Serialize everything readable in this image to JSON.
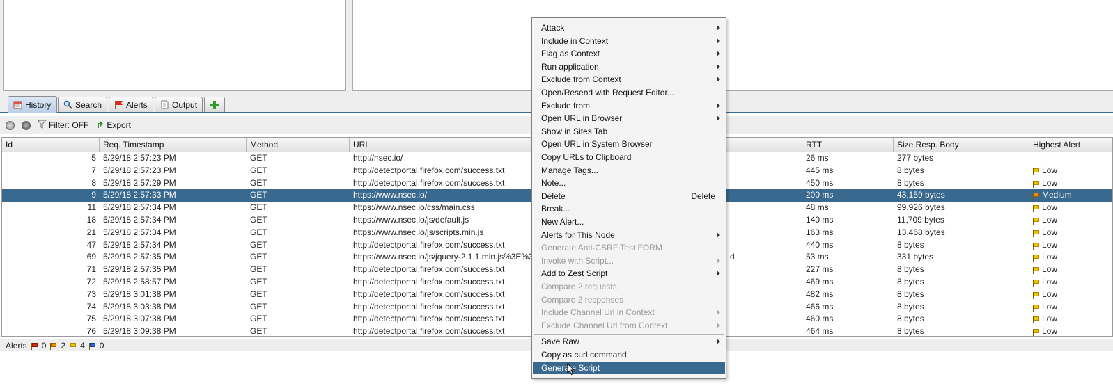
{
  "tabs": [
    {
      "label": "History",
      "icon": "history-icon",
      "active": true
    },
    {
      "label": "Search",
      "icon": "search-icon",
      "active": false
    },
    {
      "label": "Alerts",
      "icon": "alert-flag-icon",
      "active": false
    },
    {
      "label": "Output",
      "icon": "output-document-icon",
      "active": false
    }
  ],
  "toolbar": {
    "filter_label": "Filter: OFF",
    "export_label": "Export"
  },
  "columns": [
    "Id",
    "Req. Timestamp",
    "Method",
    "URL",
    "RTT",
    "Size Resp. Body",
    "Highest Alert"
  ],
  "rows": [
    {
      "id": "5",
      "ts": "5/29/18 2:57:23 PM",
      "method": "GET",
      "url": "http://nsec.io/",
      "rtt": "26 ms",
      "size": "277 bytes",
      "alert": "",
      "sev": ""
    },
    {
      "id": "7",
      "ts": "5/29/18 2:57:23 PM",
      "method": "GET",
      "url": "http://detectportal.firefox.com/success.txt",
      "rtt": "445 ms",
      "size": "8 bytes",
      "alert": "Low",
      "sev": "low"
    },
    {
      "id": "8",
      "ts": "5/29/18 2:57:29 PM",
      "method": "GET",
      "url": "http://detectportal.firefox.com/success.txt",
      "rtt": "450 ms",
      "size": "8 bytes",
      "alert": "Low",
      "sev": "low"
    },
    {
      "id": "9",
      "ts": "5/29/18 2:57:33 PM",
      "method": "GET",
      "url": "https://www.nsec.io/",
      "rtt": "200 ms",
      "size": "43,159 bytes",
      "alert": "Medium",
      "sev": "medium",
      "selected": true
    },
    {
      "id": "11",
      "ts": "5/29/18 2:57:34 PM",
      "method": "GET",
      "url": "https://www.nsec.io/css/main.css",
      "rtt": "48 ms",
      "size": "99,926 bytes",
      "alert": "Low",
      "sev": "low"
    },
    {
      "id": "18",
      "ts": "5/29/18 2:57:34 PM",
      "method": "GET",
      "url": "https://www.nsec.io/js/default.js",
      "rtt": "140 ms",
      "size": "11,709 bytes",
      "alert": "Low",
      "sev": "low"
    },
    {
      "id": "21",
      "ts": "5/29/18 2:57:34 PM",
      "method": "GET",
      "url": "https://www.nsec.io/js/scripts.min.js",
      "rtt": "163 ms",
      "size": "13,468 bytes",
      "alert": "Low",
      "sev": "low"
    },
    {
      "id": "47",
      "ts": "5/29/18 2:57:34 PM",
      "method": "GET",
      "url": "http://detectportal.firefox.com/success.txt",
      "rtt": "440 ms",
      "size": "8 bytes",
      "alert": "Low",
      "sev": "low"
    },
    {
      "id": "69",
      "ts": "5/29/18 2:57:35 PM",
      "method": "GET",
      "url": "https://www.nsec.io/js/jquery-2.1.1.min.js%3E%3",
      "rtt": "53 ms",
      "size": "331 bytes",
      "alert": "Low",
      "sev": "low",
      "tail": "d"
    },
    {
      "id": "71",
      "ts": "5/29/18 2:57:35 PM",
      "method": "GET",
      "url": "http://detectportal.firefox.com/success.txt",
      "rtt": "227 ms",
      "size": "8 bytes",
      "alert": "Low",
      "sev": "low"
    },
    {
      "id": "72",
      "ts": "5/29/18 2:58:57 PM",
      "method": "GET",
      "url": "http://detectportal.firefox.com/success.txt",
      "rtt": "469 ms",
      "size": "8 bytes",
      "alert": "Low",
      "sev": "low"
    },
    {
      "id": "73",
      "ts": "5/29/18 3:01:38 PM",
      "method": "GET",
      "url": "http://detectportal.firefox.com/success.txt",
      "rtt": "482 ms",
      "size": "8 bytes",
      "alert": "Low",
      "sev": "low"
    },
    {
      "id": "74",
      "ts": "5/29/18 3:03:38 PM",
      "method": "GET",
      "url": "http://detectportal.firefox.com/success.txt",
      "rtt": "466 ms",
      "size": "8 bytes",
      "alert": "Low",
      "sev": "low"
    },
    {
      "id": "75",
      "ts": "5/29/18 3:07:38 PM",
      "method": "GET",
      "url": "http://detectportal.firefox.com/success.txt",
      "rtt": "460 ms",
      "size": "8 bytes",
      "alert": "Low",
      "sev": "low"
    },
    {
      "id": "76",
      "ts": "5/29/18 3:09:38 PM",
      "method": "GET",
      "url": "http://detectportal.firefox.com/success.txt",
      "rtt": "464 ms",
      "size": "8 bytes",
      "alert": "Low",
      "sev": "low"
    }
  ],
  "footer": {
    "label": "Alerts",
    "high": "0",
    "medium": "2",
    "low": "4",
    "info": "0"
  },
  "menu": [
    {
      "label": "Attack",
      "submenu": true
    },
    {
      "label": "Include in Context",
      "submenu": true
    },
    {
      "label": "Flag as Context",
      "submenu": true
    },
    {
      "label": "Run application",
      "submenu": true
    },
    {
      "label": "Exclude from Context",
      "submenu": true
    },
    {
      "label": "Open/Resend with Request Editor..."
    },
    {
      "label": "Exclude from",
      "submenu": true
    },
    {
      "label": "Open URL in Browser",
      "submenu": true
    },
    {
      "label": "Show in Sites Tab"
    },
    {
      "label": "Open URL in System Browser"
    },
    {
      "label": "Copy URLs to Clipboard"
    },
    {
      "label": "Manage Tags..."
    },
    {
      "label": "Note..."
    },
    {
      "label": "Delete",
      "shortcut": "Delete"
    },
    {
      "label": "Break..."
    },
    {
      "label": "New Alert..."
    },
    {
      "label": "Alerts for This Node",
      "submenu": true
    },
    {
      "label": "Generate Anti-CSRF Test FORM",
      "disabled": true
    },
    {
      "label": "Invoke with Script...",
      "submenu": true,
      "disabled": true
    },
    {
      "label": "Add to Zest Script",
      "submenu": true
    },
    {
      "label": "Compare 2 requests",
      "disabled": true
    },
    {
      "label": "Compare 2 responses",
      "disabled": true
    },
    {
      "label": "Include Channel Url in Context",
      "submenu": true,
      "disabled": true
    },
    {
      "label": "Exclude Channel Url from Context",
      "submenu": true,
      "disabled": true
    },
    {
      "separator": true
    },
    {
      "label": "Save Raw",
      "submenu": true
    },
    {
      "label": "Copy as curl command"
    },
    {
      "label": "Generate Script",
      "highlight": true
    }
  ],
  "colors": {
    "selection": "#39698f",
    "accent_green": "#2e9d2e"
  }
}
